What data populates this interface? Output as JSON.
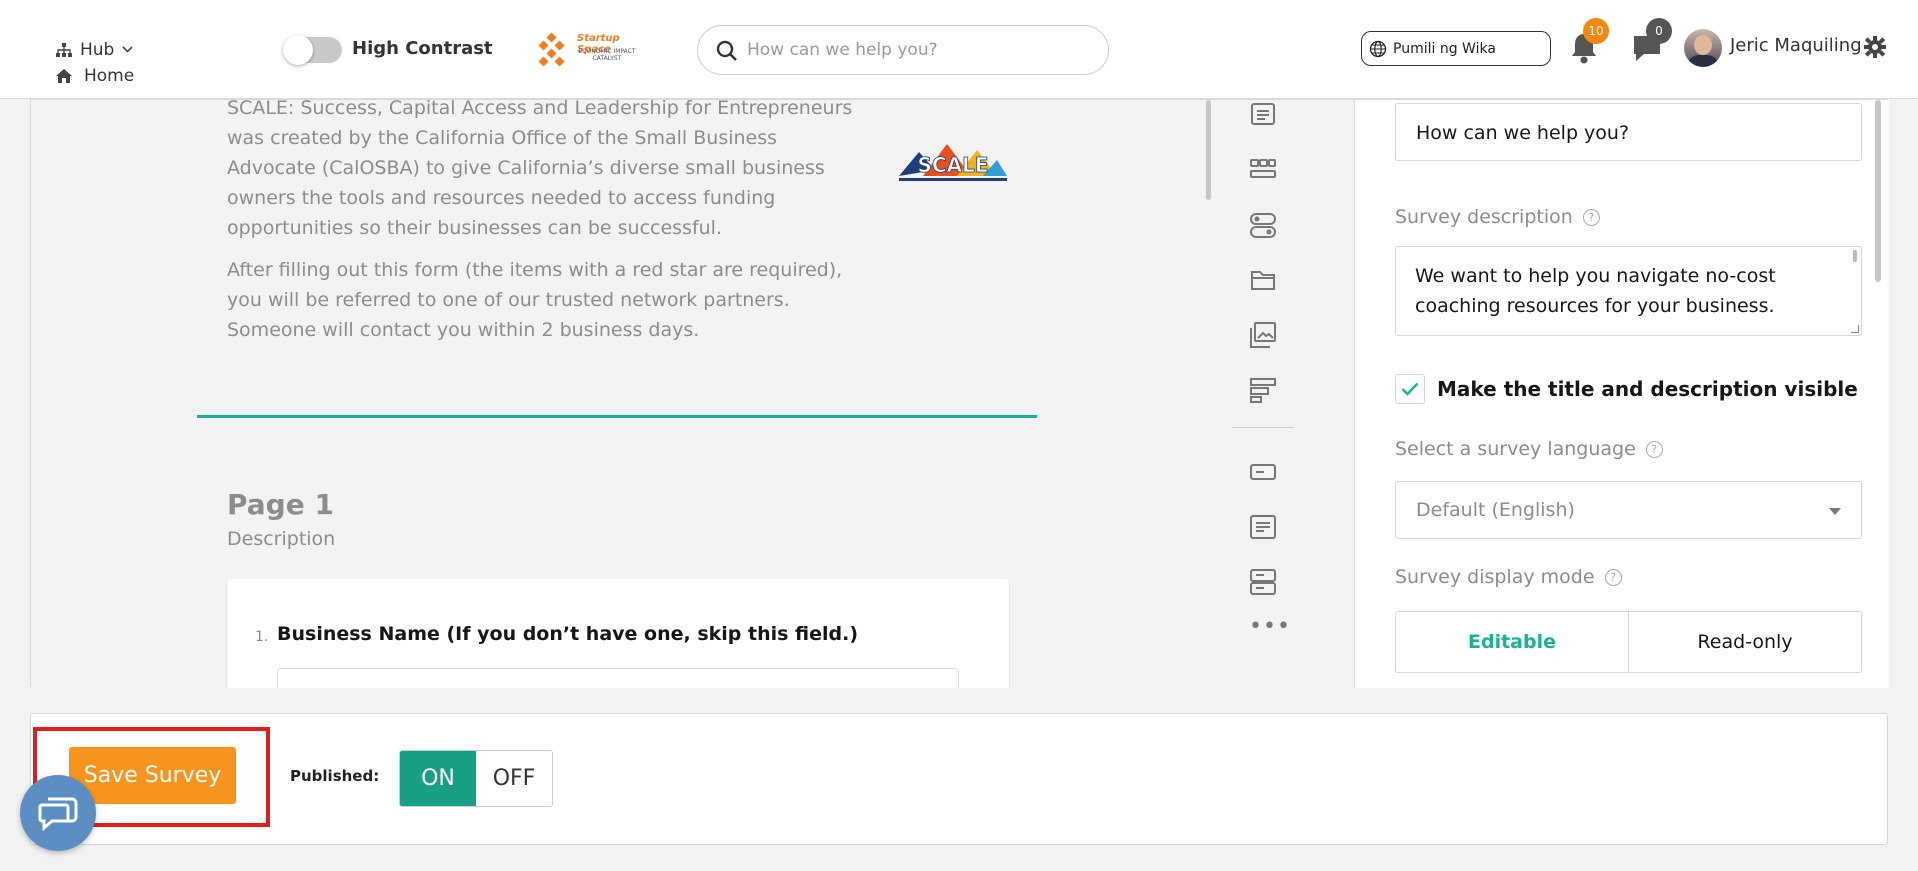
{
  "header": {
    "hub_label": "Hub",
    "home_label": "Home",
    "high_contrast_label": "High Contrast",
    "brand_title": "Startup Space",
    "brand_subtitle": "ECONOMIC IMPACT CATALYST",
    "search_placeholder": "How can we help you?",
    "language_label": "Pumili ng Wika",
    "notifications_count": "10",
    "messages_count": "0",
    "user_name": "Jeric Maquiling"
  },
  "canvas": {
    "intro_p1": "SCALE: Success, Capital Access and Leadership for Entrepreneurs was created by the California Office of the Small Business Advocate (CalOSBA) to give California’s diverse small business owners the tools and resources needed to access funding opportunities so their businesses can be successful.",
    "intro_p2": "After filling out this form (the items with a red star are required), you will be referred to one of our trusted network partners. Someone will contact you within 2 business days.",
    "logo_text": "SCALE",
    "page_title": "Page 1",
    "page_description": "Description",
    "question_number": "1.",
    "question_title": "Business Name (If you don’t have one, skip this field.)"
  },
  "toolbox": {
    "items": [
      "text-icon",
      "rating-icon",
      "toggle-icon",
      "file-icon",
      "image-picker-icon",
      "ranking-icon",
      "single-input-icon",
      "comment-icon",
      "multiple-text-icon"
    ]
  },
  "props": {
    "title_value": "How can we help you?",
    "description_label": "Survey description",
    "description_value": "We want to help you navigate no-cost coaching resources for your business.",
    "visible_label": "Make the title and description visible",
    "language_label": "Select a survey language",
    "language_value": "Default (English)",
    "display_mode_label": "Survey display mode",
    "mode_editable": "Editable",
    "mode_readonly": "Read-only"
  },
  "actionbar": {
    "save_label": "Save Survey",
    "published_label": "Published:",
    "on_label": "ON",
    "off_label": "OFF"
  },
  "colors": {
    "accent_green": "#19b394",
    "save_orange": "#f7941d",
    "highlight_red": "#e11d1d",
    "badge_orange": "#f5870f"
  }
}
